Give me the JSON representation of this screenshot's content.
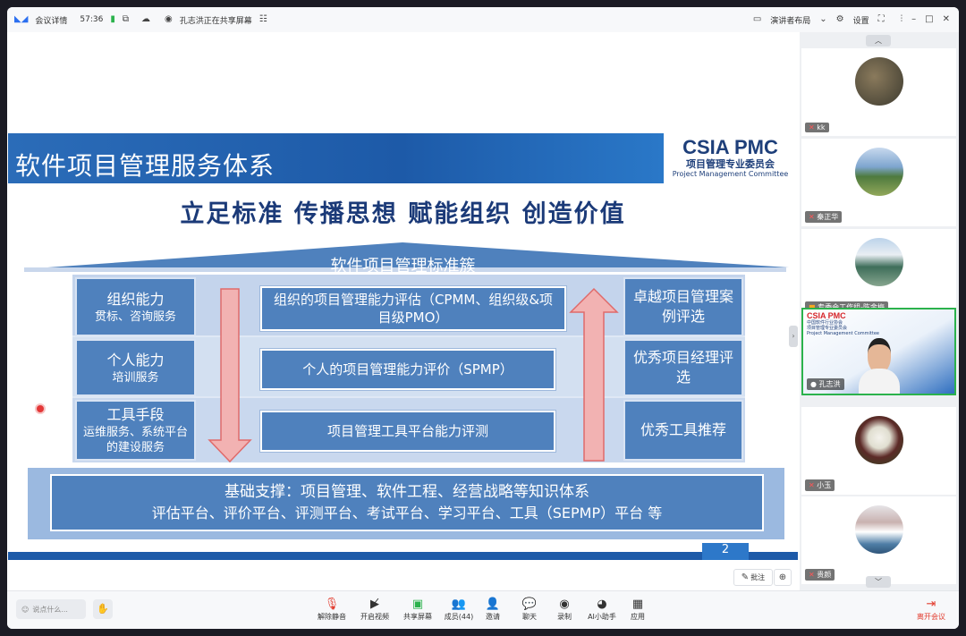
{
  "titlebar": {
    "meeting_details": "会议详情",
    "timer": "57:36",
    "sharing_text": "孔志洪正在共享屏幕",
    "presenter_layout": "演讲者布局",
    "settings": "设置"
  },
  "slide": {
    "title": "软件项目管理服务体系",
    "logo_top": "CSIA PMC",
    "logo_cn": "项目管理专业委员会",
    "logo_en": "Project Management Committee",
    "slogan": "立足标准  传播思想  赋能组织 创造价值",
    "roof_label": "软件项目管理标准簇",
    "left": [
      {
        "big": "组织能力",
        "small": "贯标、咨询服务"
      },
      {
        "big": "个人能力",
        "small": "培训服务"
      },
      {
        "big": "工具手段",
        "small": "运维服务、系统平台的建设服务"
      }
    ],
    "middle": [
      "组织的项目管理能力评估（CPMM、组织级&项目级PMO）",
      "个人的项目管理能力评价（SPMP）",
      "项目管理工具平台能力评测"
    ],
    "right": [
      "卓越项目管理案例评选",
      "优秀项目经理评选",
      "优秀工具推荐"
    ],
    "base_line1": "基础支撑：项目管理、软件工程、经营战略等知识体系",
    "base_line2": "评估平台、评价平台、评测平台、考试平台、学习平台、工具（SEPMP）平台 等",
    "page_number": "2"
  },
  "annotate_label": "批注",
  "participants": [
    {
      "name": "kk"
    },
    {
      "name": "秦正华"
    },
    {
      "name": "专委会工作组-陈金梅"
    },
    {
      "name": "孔志洪"
    },
    {
      "name": "小玉"
    },
    {
      "name": "贵颜"
    }
  ],
  "presenter_logo": {
    "top": "CSIA PMC",
    "cn1": "中国软件行业协会",
    "cn2": "项目管理专业委员会",
    "en": "Project Management Committee"
  },
  "bottombar": {
    "chat_placeholder": "说点什么...",
    "mute": "解除静音",
    "video": "开启视频",
    "share": "共享屏幕",
    "members": "成员(44)",
    "invite": "邀请",
    "chat": "聊天",
    "record": "录制",
    "ai": "AI小助手",
    "apps": "应用",
    "leave": "离开会议"
  },
  "colors": {
    "slide_blue": "#4f81bd",
    "dark_navy": "#1b3a78",
    "leave_red": "#e23c2e",
    "logo_red": "#d6262b"
  }
}
